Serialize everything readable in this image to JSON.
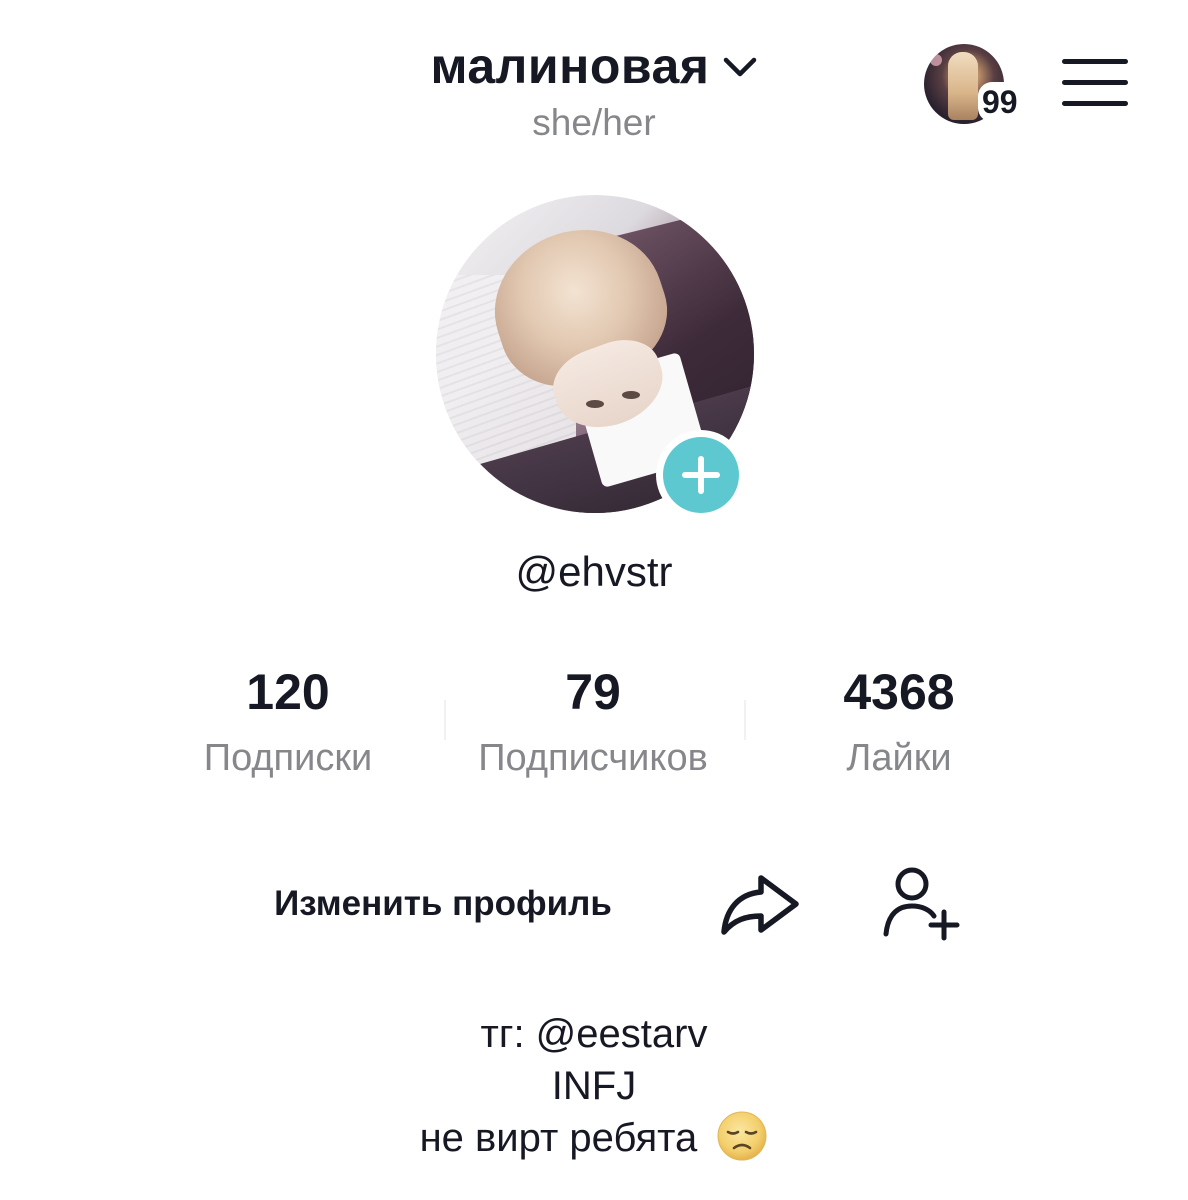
{
  "header": {
    "display_name": "малиновая",
    "pronouns": "she/her",
    "story_count": "99"
  },
  "profile": {
    "handle": "@ehvstr"
  },
  "stats": {
    "following": {
      "value": "120",
      "label": "Подписки"
    },
    "followers": {
      "value": "79",
      "label": "Подписчиков"
    },
    "likes": {
      "value": "4368",
      "label": "Лайки"
    }
  },
  "actions": {
    "edit_profile_label": "Изменить профиль"
  },
  "bio": {
    "lines": [
      "тг: @eestarv",
      "INFJ",
      "не вирт ребята"
    ],
    "emoji": "disappointed-face"
  },
  "colors": {
    "text_primary": "#161823",
    "text_secondary": "#86878b",
    "add_photo_accent": "#5ec8d0"
  },
  "icons": {
    "chevron": "chevron-down-icon",
    "menu": "hamburger-menu-icon",
    "add_photo": "plus-icon",
    "share": "share-arrow-icon",
    "add_friend": "add-user-icon"
  }
}
